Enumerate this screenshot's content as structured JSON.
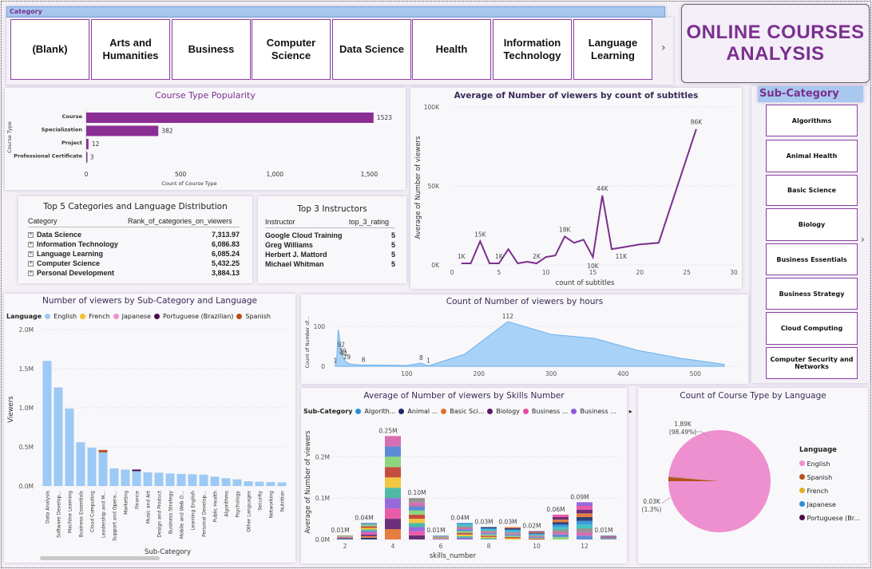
{
  "category_slicer": {
    "header": "Category",
    "items": [
      "(Blank)",
      "Arts and Humanities",
      "Business",
      "Computer Science",
      "Data Science",
      "Health",
      "Information Technology",
      "Language Learning"
    ]
  },
  "report_title": "ONLINE COURSES ANALYSIS",
  "subcategory_slicer": {
    "header": "Sub-Category",
    "items": [
      "Algorithms",
      "Animal Health",
      "Basic Science",
      "Biology",
      "Business Essentials",
      "Business Strategy",
      "Cloud Computing",
      "Computer Security and Networks"
    ]
  },
  "course_type": {
    "title": "Course Type Popularity",
    "ylabel": "Course Type",
    "xlabel": "Count of Course Type",
    "chart_data": {
      "type": "bar",
      "categories": [
        "Course",
        "Specialization",
        "Project",
        "Professional Certificate"
      ],
      "values": [
        1523,
        382,
        12,
        3
      ],
      "xlim": [
        0,
        1600
      ],
      "ticks": [
        "0",
        "500",
        "1,000",
        "1,500"
      ]
    }
  },
  "subtitles": {
    "title": "Average of Number of viewers by count of subtitles",
    "xlabel": "count of subtitles",
    "ylabel": "Average of Number of viewers",
    "chart_data": {
      "type": "line",
      "x": [
        1,
        2,
        3,
        4,
        5,
        6,
        7,
        8,
        9,
        10,
        11,
        12,
        13,
        14,
        15,
        16,
        17,
        18,
        20,
        22,
        26
      ],
      "y": [
        1000,
        1000,
        15000,
        1000,
        1000,
        10000,
        1000,
        2000,
        1000,
        5000,
        6000,
        18000,
        14000,
        16000,
        5000,
        44000,
        10000,
        11000,
        13000,
        14000,
        86000
      ],
      "labels": [
        {
          "x": 1,
          "text": "1K"
        },
        {
          "x": 3,
          "text": "15K"
        },
        {
          "x": 5,
          "text": "1K"
        },
        {
          "x": 9,
          "text": "2K"
        },
        {
          "x": 12,
          "text": "18K"
        },
        {
          "x": 15,
          "text": "10K"
        },
        {
          "x": 16,
          "text": "44K"
        },
        {
          "x": 18,
          "text": "11K"
        },
        {
          "x": 26,
          "text": "86K"
        }
      ],
      "xticks": [
        "0",
        "5",
        "10",
        "15",
        "20",
        "25",
        "30"
      ],
      "yticks": [
        "0K",
        "50K",
        "100K"
      ],
      "xlim": [
        0,
        30
      ],
      "ylim": [
        0,
        100000
      ]
    }
  },
  "top5": {
    "title": "Top 5 Categories and Language Distribution",
    "col1": "Category",
    "col2": "Rank_of_categories_on_viewers",
    "rows": [
      {
        "name": "Data Science",
        "value": "7,313.97"
      },
      {
        "name": "Information Technology",
        "value": "6,086.83"
      },
      {
        "name": "Language Learning",
        "value": "6,085.24"
      },
      {
        "name": "Computer Science",
        "value": "5,432.25"
      },
      {
        "name": "Personal Development",
        "value": "3,884.13"
      }
    ]
  },
  "instructors": {
    "title": "Top 3 Instructors",
    "col1": "Instructor",
    "col2": "top_3_rating",
    "rows": [
      {
        "name": "Google Cloud Training",
        "value": "5"
      },
      {
        "name": "Greg Williams",
        "value": "5"
      },
      {
        "name": "Herbert J. Mattord",
        "value": "5"
      },
      {
        "name": "Michael Whitman",
        "value": "5"
      }
    ]
  },
  "viewers_subcat": {
    "title": "Number of viewers by Sub-Category and Language",
    "legend_title": "Language",
    "legend": [
      {
        "name": "English",
        "color": "#9cc9f5"
      },
      {
        "name": "French",
        "color": "#f2c12e"
      },
      {
        "name": "Japanese",
        "color": "#ee8fcf"
      },
      {
        "name": "Portuguese (Brazilian)",
        "color": "#4a0a4a"
      },
      {
        "name": "Spanish",
        "color": "#b5501e"
      }
    ],
    "xlabel": "Sub-Category",
    "ylabel": "Viewers",
    "chart_data": {
      "type": "bar",
      "categories": [
        "Data Analysis",
        "Software Develop...",
        "Machine Learning",
        "Business Essentials",
        "Cloud Computing",
        "Leadership and M...",
        "Support and Opera...",
        "Marketing",
        "Finance",
        "Music and Art",
        "Design and Product",
        "Business Strategy",
        "Mobile and Web D...",
        "Learning English",
        "Personal Develop...",
        "Public Health",
        "Algorithms",
        "Psychology",
        "Other Languages",
        "Security",
        "Networking",
        "Nutrition"
      ],
      "values": [
        1600000,
        1260000,
        990000,
        560000,
        490000,
        430000,
        225000,
        210000,
        190000,
        175000,
        170000,
        160000,
        155000,
        150000,
        145000,
        120000,
        100000,
        85000,
        60000,
        55000,
        50000,
        45000
      ],
      "yticks": [
        "0.0M",
        "0.5M",
        "1.0M",
        "1.5M",
        "2.0M"
      ],
      "ylim": [
        0,
        2000000
      ]
    }
  },
  "hours": {
    "title": "Count of Number of viewers by hours",
    "ylabel": "Count of Number of...",
    "chart_data": {
      "type": "area",
      "x": [
        1,
        3,
        5,
        7,
        9,
        11,
        13,
        15,
        17,
        19,
        21,
        25,
        30,
        40,
        60,
        100,
        120,
        130,
        180,
        240,
        300,
        360,
        420,
        480,
        540
      ],
      "y": [
        1,
        20,
        92,
        70,
        41,
        25,
        19,
        12,
        10,
        8,
        6,
        5,
        4,
        3,
        3,
        2,
        8,
        1,
        30,
        112,
        80,
        70,
        40,
        20,
        5
      ],
      "labels": [
        {
          "x": 1,
          "text": "1"
        },
        {
          "x": 9,
          "text": "92"
        },
        {
          "x": 11,
          "text": "39"
        },
        {
          "x": 13,
          "text": "41"
        },
        {
          "x": 17,
          "text": "19"
        },
        {
          "x": 40,
          "text": "8"
        },
        {
          "x": 120,
          "text": "8"
        },
        {
          "x": 130,
          "text": "1"
        },
        {
          "x": 240,
          "text": "112"
        }
      ],
      "xticks": [
        "100",
        "200",
        "300",
        "400",
        "500"
      ],
      "yticks": [
        "0",
        "100"
      ],
      "xlim": [
        0,
        560
      ],
      "ylim": [
        0,
        130
      ]
    }
  },
  "skills": {
    "title": "Average of Number of viewers by Skills Number",
    "legend_title": "Sub-Category",
    "legend": [
      {
        "name": "Algorith...",
        "color": "#2a8fd8"
      },
      {
        "name": "Animal ...",
        "color": "#1a2a6a"
      },
      {
        "name": "Basic Sci...",
        "color": "#e36f2c"
      },
      {
        "name": "Biology",
        "color": "#5a1a6a"
      },
      {
        "name": "Business ...",
        "color": "#e84a9e"
      },
      {
        "name": "Business ...",
        "color": "#8c5ad8"
      }
    ],
    "xlabel": "skills_number",
    "ylabel": "Average of Number of viewers",
    "chart_data": {
      "type": "area",
      "x": [
        2,
        3,
        4,
        5,
        6,
        7,
        8,
        9,
        10,
        11,
        12,
        13
      ],
      "y": [
        10000,
        40000,
        250000,
        100000,
        10000,
        40000,
        30000,
        30000,
        20000,
        60000,
        90000,
        10000
      ],
      "labels": [
        "0.01M",
        "0.04M",
        "0.25M",
        "0.10M",
        "0.01M",
        "0.04M",
        "0.03M",
        "0.03M",
        "0.02M",
        "0.06M",
        "0.09M",
        "0.01M"
      ],
      "xticks": [
        "2",
        "4",
        "6",
        "8",
        "10",
        "12"
      ],
      "yticks": [
        "0.0M",
        "0.1M",
        "0.2M"
      ],
      "ylim": [
        0,
        270000
      ]
    }
  },
  "lang_pie": {
    "title": "Count of Course Type by Language",
    "legend_title": "Language",
    "legend": [
      {
        "name": "English",
        "color": "#ee8fcf"
      },
      {
        "name": "Spanish",
        "color": "#b5501e"
      },
      {
        "name": "French",
        "color": "#e0b020"
      },
      {
        "name": "Japanese",
        "color": "#2a8fd8"
      },
      {
        "name": "Portuguese (Br...",
        "color": "#4a0a4a"
      }
    ],
    "chart_data": {
      "type": "pie",
      "categories": [
        "English",
        "Spanish",
        "French",
        "Japanese",
        "Portuguese (Brazilian)"
      ],
      "values": [
        1890,
        25,
        2,
        1,
        1
      ],
      "label_main": "1.89K",
      "label_main_pct": "(98.49%)",
      "label_small": "0.03K",
      "label_small_pct": "(1.3%)"
    }
  }
}
